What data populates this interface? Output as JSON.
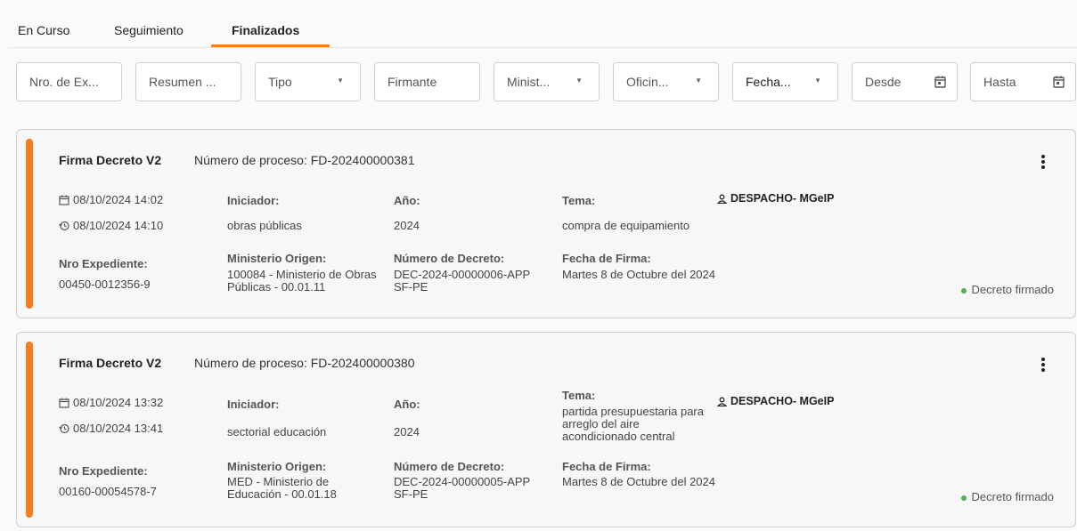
{
  "tabs": [
    {
      "label": "En Curso"
    },
    {
      "label": "Seguimiento"
    },
    {
      "label": "Finalizados"
    }
  ],
  "filters": [
    {
      "label": "Nro. de Ex..."
    },
    {
      "label": "Resumen ..."
    },
    {
      "label": "Tipo"
    },
    {
      "label": "Firmante"
    },
    {
      "label": "Minist..."
    },
    {
      "label": "Oficin..."
    },
    {
      "label": "Fecha..."
    },
    {
      "label": "Desde"
    },
    {
      "label": "Hasta"
    }
  ],
  "labels": {
    "iniciador": "Iniciador:",
    "anio": "Año:",
    "tema": "Tema:",
    "nro_expediente": "Nro Expediente:",
    "ministerio_origen": "Ministerio Origen:",
    "numero_decreto": "Número de Decreto:",
    "fecha_firma": "Fecha de Firma:"
  },
  "cards": [
    {
      "title": "Firma Decreto V2",
      "process_number": "Número de proceso: FD-202400000381",
      "created": "08/10/2024 14:02",
      "updated": "08/10/2024 14:10",
      "iniciador": "obras públicas",
      "anio": "2024",
      "tema": "compra de equipamiento",
      "office": "DESPACHO- MGeIP",
      "nro_expediente": "00450-0012356-9",
      "ministerio_origen": "100084 - Ministerio de Obras Públicas - 00.01.11",
      "numero_decreto": "DEC-2024-00000006-APPSF-PE",
      "fecha_firma": "Martes 8 de Octubre del 2024",
      "status": "Decreto firmado"
    },
    {
      "title": "Firma Decreto V2",
      "process_number": "Número de proceso: FD-202400000380",
      "created": "08/10/2024 13:32",
      "updated": "08/10/2024 13:41",
      "iniciador": "sectorial educación",
      "anio": "2024",
      "tema": "partida presupuestaria para arreglo del aire acondicionado central",
      "office": "DESPACHO- MGeIP",
      "nro_expediente": "00160-00054578-7",
      "ministerio_origen": "MED - Ministerio de Educación - 00.01.18",
      "numero_decreto": "DEC-2024-00000005-APPSF-PE",
      "fecha_firma": "Martes 8 de Octubre del 2024",
      "status": "Decreto firmado"
    }
  ],
  "colors": {
    "accent": "#f57c1f",
    "status_ok": "#4caf50"
  }
}
